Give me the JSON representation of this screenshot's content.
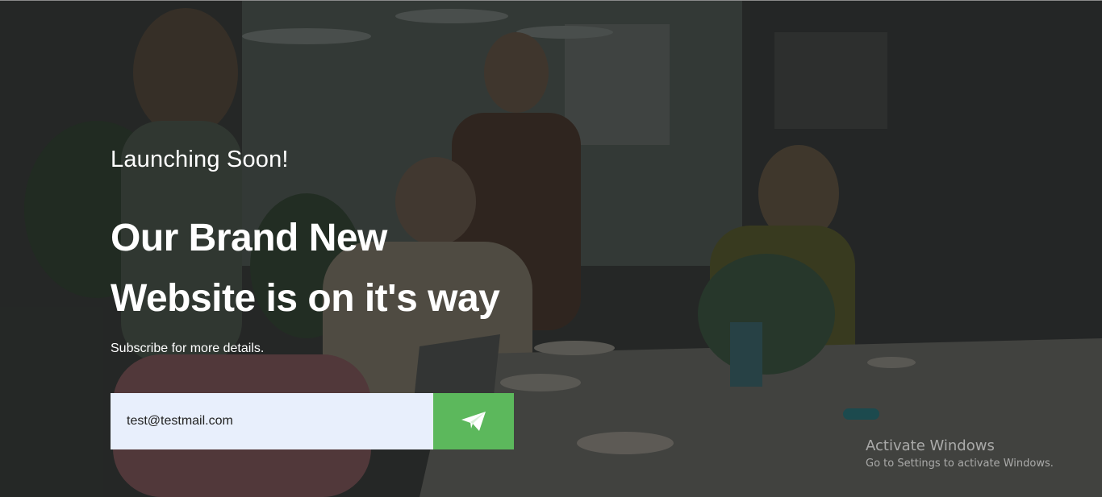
{
  "hero": {
    "eyebrow": "Launching Soon!",
    "headline_line1": "Our Brand New",
    "headline_line2": "Website is on it's way",
    "subtext": "Subscribe for more details."
  },
  "subscribe": {
    "email_value": "test@testmail.com",
    "button_icon": "paper-plane-icon",
    "button_color": "#5cb85c",
    "input_background": "#e8effc"
  },
  "watermark": {
    "title": "Activate Windows",
    "subtitle": "Go to Settings to activate Windows."
  }
}
